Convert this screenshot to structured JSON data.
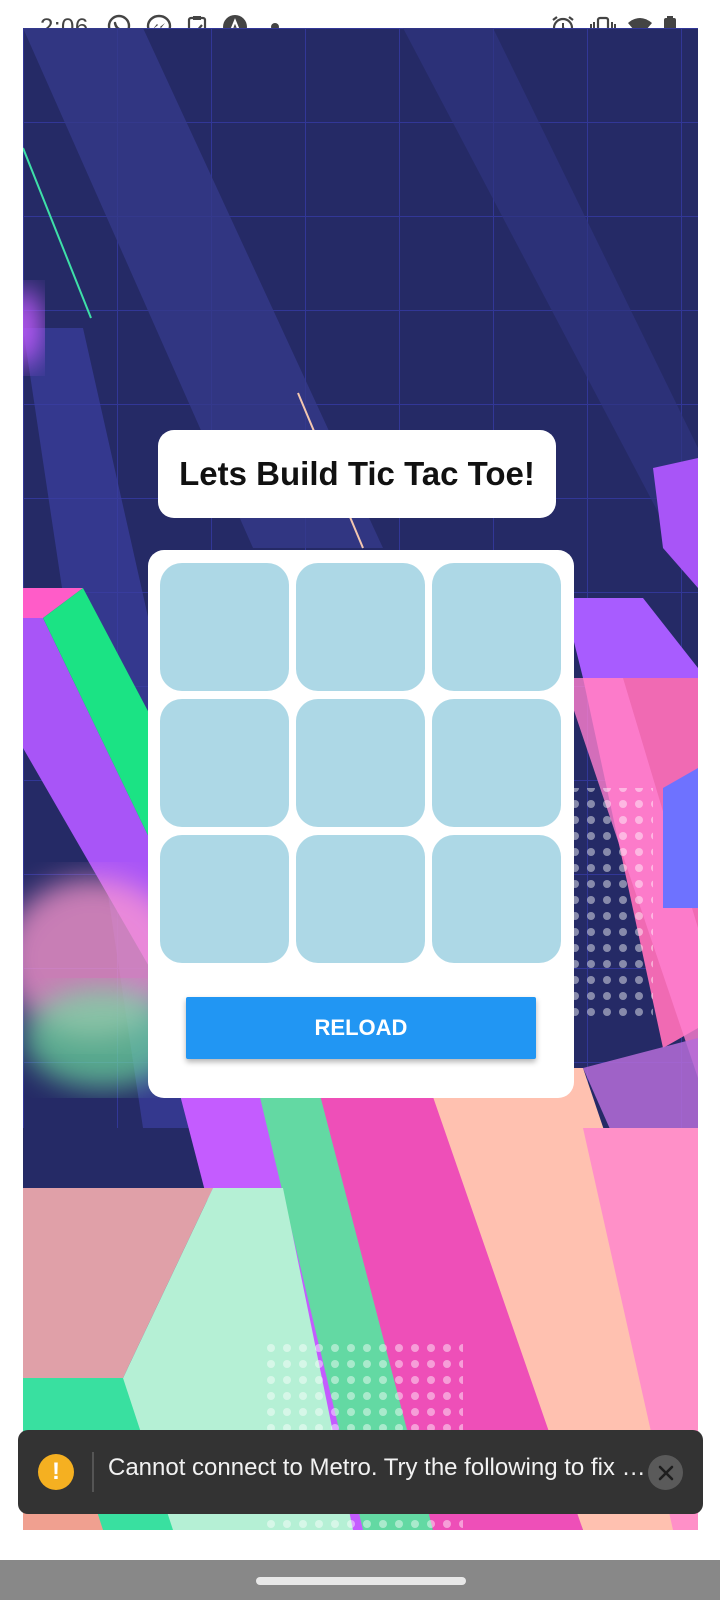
{
  "status_bar": {
    "time": "2:06",
    "left_icons": [
      "whatsapp-icon",
      "messenger-icon",
      "clipboard-check-icon",
      "app-a-icon",
      "dot-icon"
    ],
    "right_icons": [
      "alarm-icon",
      "vibrate-icon",
      "wifi-icon",
      "battery-icon"
    ]
  },
  "game": {
    "title": "Lets Build Tic Tac Toe!",
    "board": [
      "",
      "",
      "",
      "",
      "",
      "",
      "",
      "",
      ""
    ],
    "reload_label": "RELOAD"
  },
  "toast": {
    "message": "Cannot connect to Metro.  Try the following to fix the issue:",
    "icon": "warning-icon"
  },
  "colors": {
    "cell": "#add8e6",
    "reload_button": "#2196f3",
    "background_navy": "#252a66"
  }
}
